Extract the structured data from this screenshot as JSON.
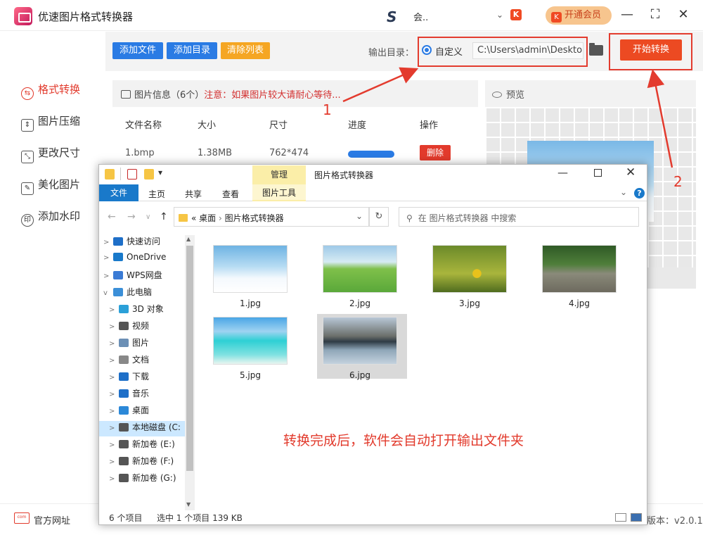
{
  "app": {
    "title": "优速图片格式转换器",
    "user_name": "会..",
    "user_logo_glyph": "S",
    "vip_small_glyph": "K",
    "vip_label": "开通会员",
    "window_controls": [
      "—",
      "⛶",
      "✕"
    ]
  },
  "sidebar": {
    "items": [
      {
        "label": "格式转换",
        "icon": "refresh-circle-icon",
        "glyph": "⇆"
      },
      {
        "label": "图片压缩",
        "icon": "compress-icon",
        "glyph": "⇕"
      },
      {
        "label": "更改尺寸",
        "icon": "resize-icon",
        "glyph": "⤡"
      },
      {
        "label": "美化图片",
        "icon": "beautify-icon",
        "glyph": "✎"
      },
      {
        "label": "添加水印",
        "icon": "watermark-icon",
        "glyph": "印"
      }
    ]
  },
  "toolbar": {
    "add_file": "添加文件",
    "add_dir": "添加目录",
    "clear_list": "清除列表",
    "output_label": "输出目录：",
    "radio_label": "自定义",
    "output_path": "C:\\Users\\admin\\Desktop",
    "start": "开始转换"
  },
  "file_info": {
    "title": "图片信息（6个）",
    "warning": "注意：如果图片较大请耐心等待...",
    "columns": [
      "文件名称",
      "大小",
      "尺寸",
      "进度",
      "操作"
    ],
    "rows": [
      {
        "name": "1.bmp",
        "size": "1.38MB",
        "dims": "762*474",
        "progress": 1.0,
        "action": "删除"
      }
    ]
  },
  "preview": {
    "title": "预览"
  },
  "annotations": {
    "one": "1",
    "two": "2"
  },
  "footer": {
    "site": "官方网址",
    "site_icon_text": "com",
    "version": "版本：v2.0.1"
  },
  "explorer": {
    "tab_manage": "管理",
    "title": "图片格式转换器",
    "ribbon": {
      "file": "文件",
      "home": "主页",
      "share": "共享",
      "view": "查看",
      "image_tools": "图片工具"
    },
    "help": "?",
    "address": {
      "prefix": "«",
      "crumb1": "桌面",
      "crumb2": "图片格式转换器"
    },
    "refresh": "↻",
    "search_placeholder": "在 图片格式转换器 中搜索",
    "tree": [
      {
        "label": "快速访问",
        "icon": "star-icon",
        "color": "#1e6fc8",
        "indent": 0,
        "arrow": ">"
      },
      {
        "label": "OneDrive",
        "icon": "cloud-icon",
        "color": "#1979ca",
        "indent": 0,
        "arrow": ">"
      },
      {
        "label": "WPS网盘",
        "icon": "cloud-icon",
        "color": "#3a7bd5",
        "indent": 0,
        "arrow": ">"
      },
      {
        "label": "此电脑",
        "icon": "computer-icon",
        "color": "#3b8fd8",
        "indent": 0,
        "arrow": "v"
      },
      {
        "label": "3D 对象",
        "icon": "cube-icon",
        "color": "#2ba0d8",
        "indent": 1,
        "arrow": ">"
      },
      {
        "label": "视频",
        "icon": "film-icon",
        "color": "#555",
        "indent": 1,
        "arrow": ">"
      },
      {
        "label": "图片",
        "icon": "picture-icon",
        "color": "#6b8fb5",
        "indent": 1,
        "arrow": ">"
      },
      {
        "label": "文档",
        "icon": "document-icon",
        "color": "#888",
        "indent": 1,
        "arrow": ">"
      },
      {
        "label": "下载",
        "icon": "download-icon",
        "color": "#1e6fc8",
        "indent": 1,
        "arrow": ">"
      },
      {
        "label": "音乐",
        "icon": "music-icon",
        "color": "#1e6fc8",
        "indent": 1,
        "arrow": ">"
      },
      {
        "label": "桌面",
        "icon": "desktop-icon",
        "color": "#2b88d8",
        "indent": 1,
        "arrow": ">"
      },
      {
        "label": "本地磁盘 (C:",
        "icon": "drive-icon",
        "color": "#555",
        "indent": 1,
        "arrow": ">",
        "selected": true
      },
      {
        "label": "新加卷 (E:)",
        "icon": "drive-icon",
        "color": "#555",
        "indent": 1,
        "arrow": ">"
      },
      {
        "label": "新加卷 (F:)",
        "icon": "drive-icon",
        "color": "#555",
        "indent": 1,
        "arrow": ">"
      },
      {
        "label": "新加卷 (G:)",
        "icon": "drive-icon",
        "color": "#555",
        "indent": 1,
        "arrow": ">"
      }
    ],
    "files": [
      {
        "name": "1.jpg",
        "style": "sky"
      },
      {
        "name": "2.jpg",
        "style": "meadow"
      },
      {
        "name": "3.jpg",
        "style": "flowers"
      },
      {
        "name": "4.jpg",
        "style": "river"
      },
      {
        "name": "5.jpg",
        "style": "beach"
      },
      {
        "name": "6.jpg",
        "style": "lake",
        "selected": true
      }
    ],
    "note": "转换完成后，软件会自动打开输出文件夹",
    "status": {
      "count": "6 个项目",
      "selection": "选中 1 个项目  139 KB"
    }
  }
}
